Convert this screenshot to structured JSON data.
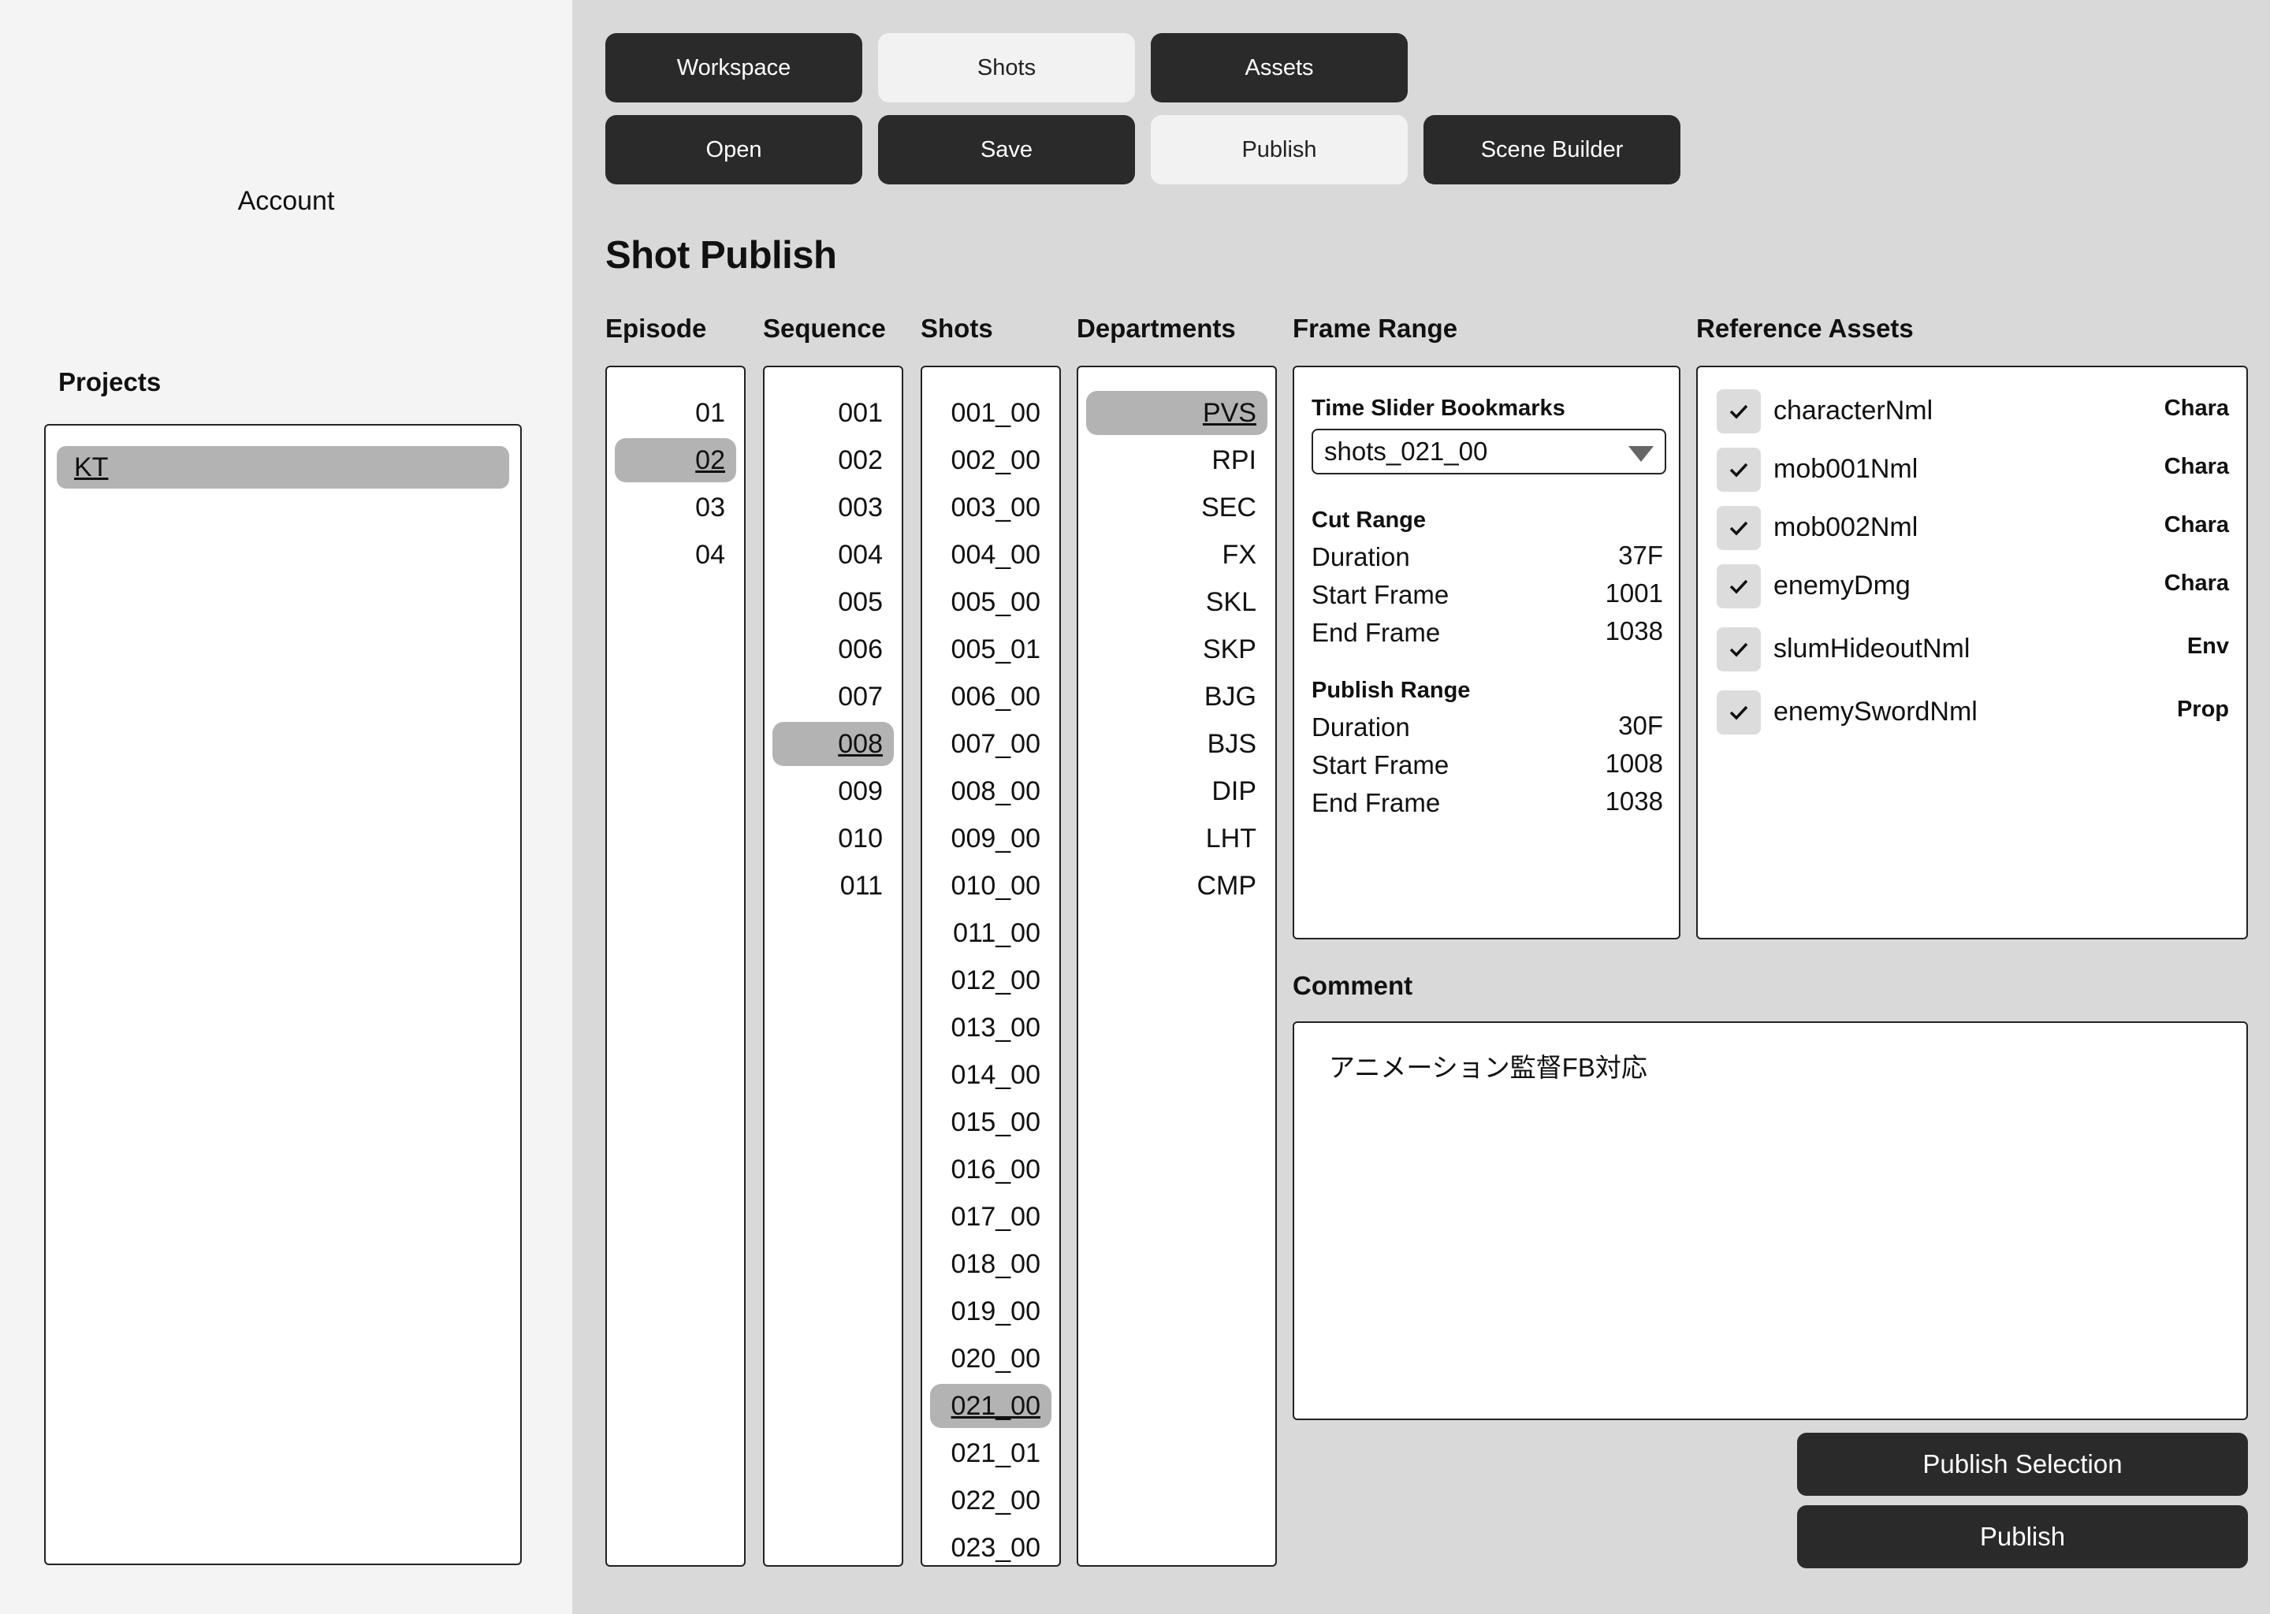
{
  "sidebar": {
    "account_label": "Account",
    "projects_label": "Projects",
    "projects": [
      {
        "label": "KT",
        "selected": true
      }
    ]
  },
  "toolbar": {
    "row1": [
      {
        "label": "Workspace",
        "style": "dark"
      },
      {
        "label": "Shots",
        "style": "light"
      },
      {
        "label": "Assets",
        "style": "dark"
      }
    ],
    "row2": [
      {
        "label": "Open",
        "style": "dark"
      },
      {
        "label": "Save",
        "style": "dark"
      },
      {
        "label": "Publish",
        "style": "light"
      },
      {
        "label": "Scene Builder",
        "style": "dark"
      }
    ]
  },
  "page_title": "Shot Publish",
  "episode": {
    "header": "Episode",
    "items": [
      "01",
      "02",
      "03",
      "04"
    ],
    "selected": "02"
  },
  "sequence": {
    "header": "Sequence",
    "items": [
      "001",
      "002",
      "003",
      "004",
      "005",
      "006",
      "007",
      "008",
      "009",
      "010",
      "011"
    ],
    "selected": "008"
  },
  "shots": {
    "header": "Shots",
    "items": [
      "001_00",
      "002_00",
      "003_00",
      "004_00",
      "005_00",
      "005_01",
      "006_00",
      "007_00",
      "008_00",
      "009_00",
      "010_00",
      "011_00",
      "012_00",
      "013_00",
      "014_00",
      "015_00",
      "016_00",
      "017_00",
      "018_00",
      "019_00",
      "020_00",
      "021_00",
      "021_01",
      "022_00",
      "023_00"
    ],
    "selected": "021_00"
  },
  "departments": {
    "header": "Departments",
    "items": [
      "PVS",
      "RPI",
      "SEC",
      "FX",
      "SKL",
      "SKP",
      "BJG",
      "BJS",
      "DIP",
      "LHT",
      "CMP"
    ],
    "selected": "PVS"
  },
  "frame_range": {
    "header": "Frame Range",
    "bookmarks_label": "Time Slider Bookmarks",
    "bookmark_value": "shots_021_00",
    "cut_range": {
      "label": "Cut Range",
      "duration_label": "Duration",
      "duration": "37F",
      "start_label": "Start Frame",
      "start": "1001",
      "end_label": "End Frame",
      "end": "1038"
    },
    "publish_range": {
      "label": "Publish Range",
      "duration_label": "Duration",
      "duration": "30F",
      "start_label": "Start Frame",
      "start": "1008",
      "end_label": "End Frame",
      "end": "1038"
    }
  },
  "reference_assets": {
    "header": "Reference Assets",
    "items": [
      {
        "name": "characterNml",
        "type": "Chara",
        "checked": true
      },
      {
        "name": "mob001Nml",
        "type": "Chara",
        "checked": true
      },
      {
        "name": "mob002Nml",
        "type": "Chara",
        "checked": true
      },
      {
        "name": "enemyDmg",
        "type": "Chara",
        "checked": true
      },
      {
        "name": "slumHideoutNml",
        "type": "Env",
        "checked": true
      },
      {
        "name": "enemySwordNml",
        "type": "Prop",
        "checked": true
      }
    ]
  },
  "comment": {
    "label": "Comment",
    "text": "アニメーション監督FB対応"
  },
  "actions": {
    "publish_selection": "Publish Selection",
    "publish": "Publish"
  },
  "colors": {
    "dark_button": "#2a2a2a",
    "light_button": "#f2f2f2",
    "selection": "#b3b3b3",
    "background": "#d9d9d9",
    "sidebar": "#f4f4f4"
  }
}
